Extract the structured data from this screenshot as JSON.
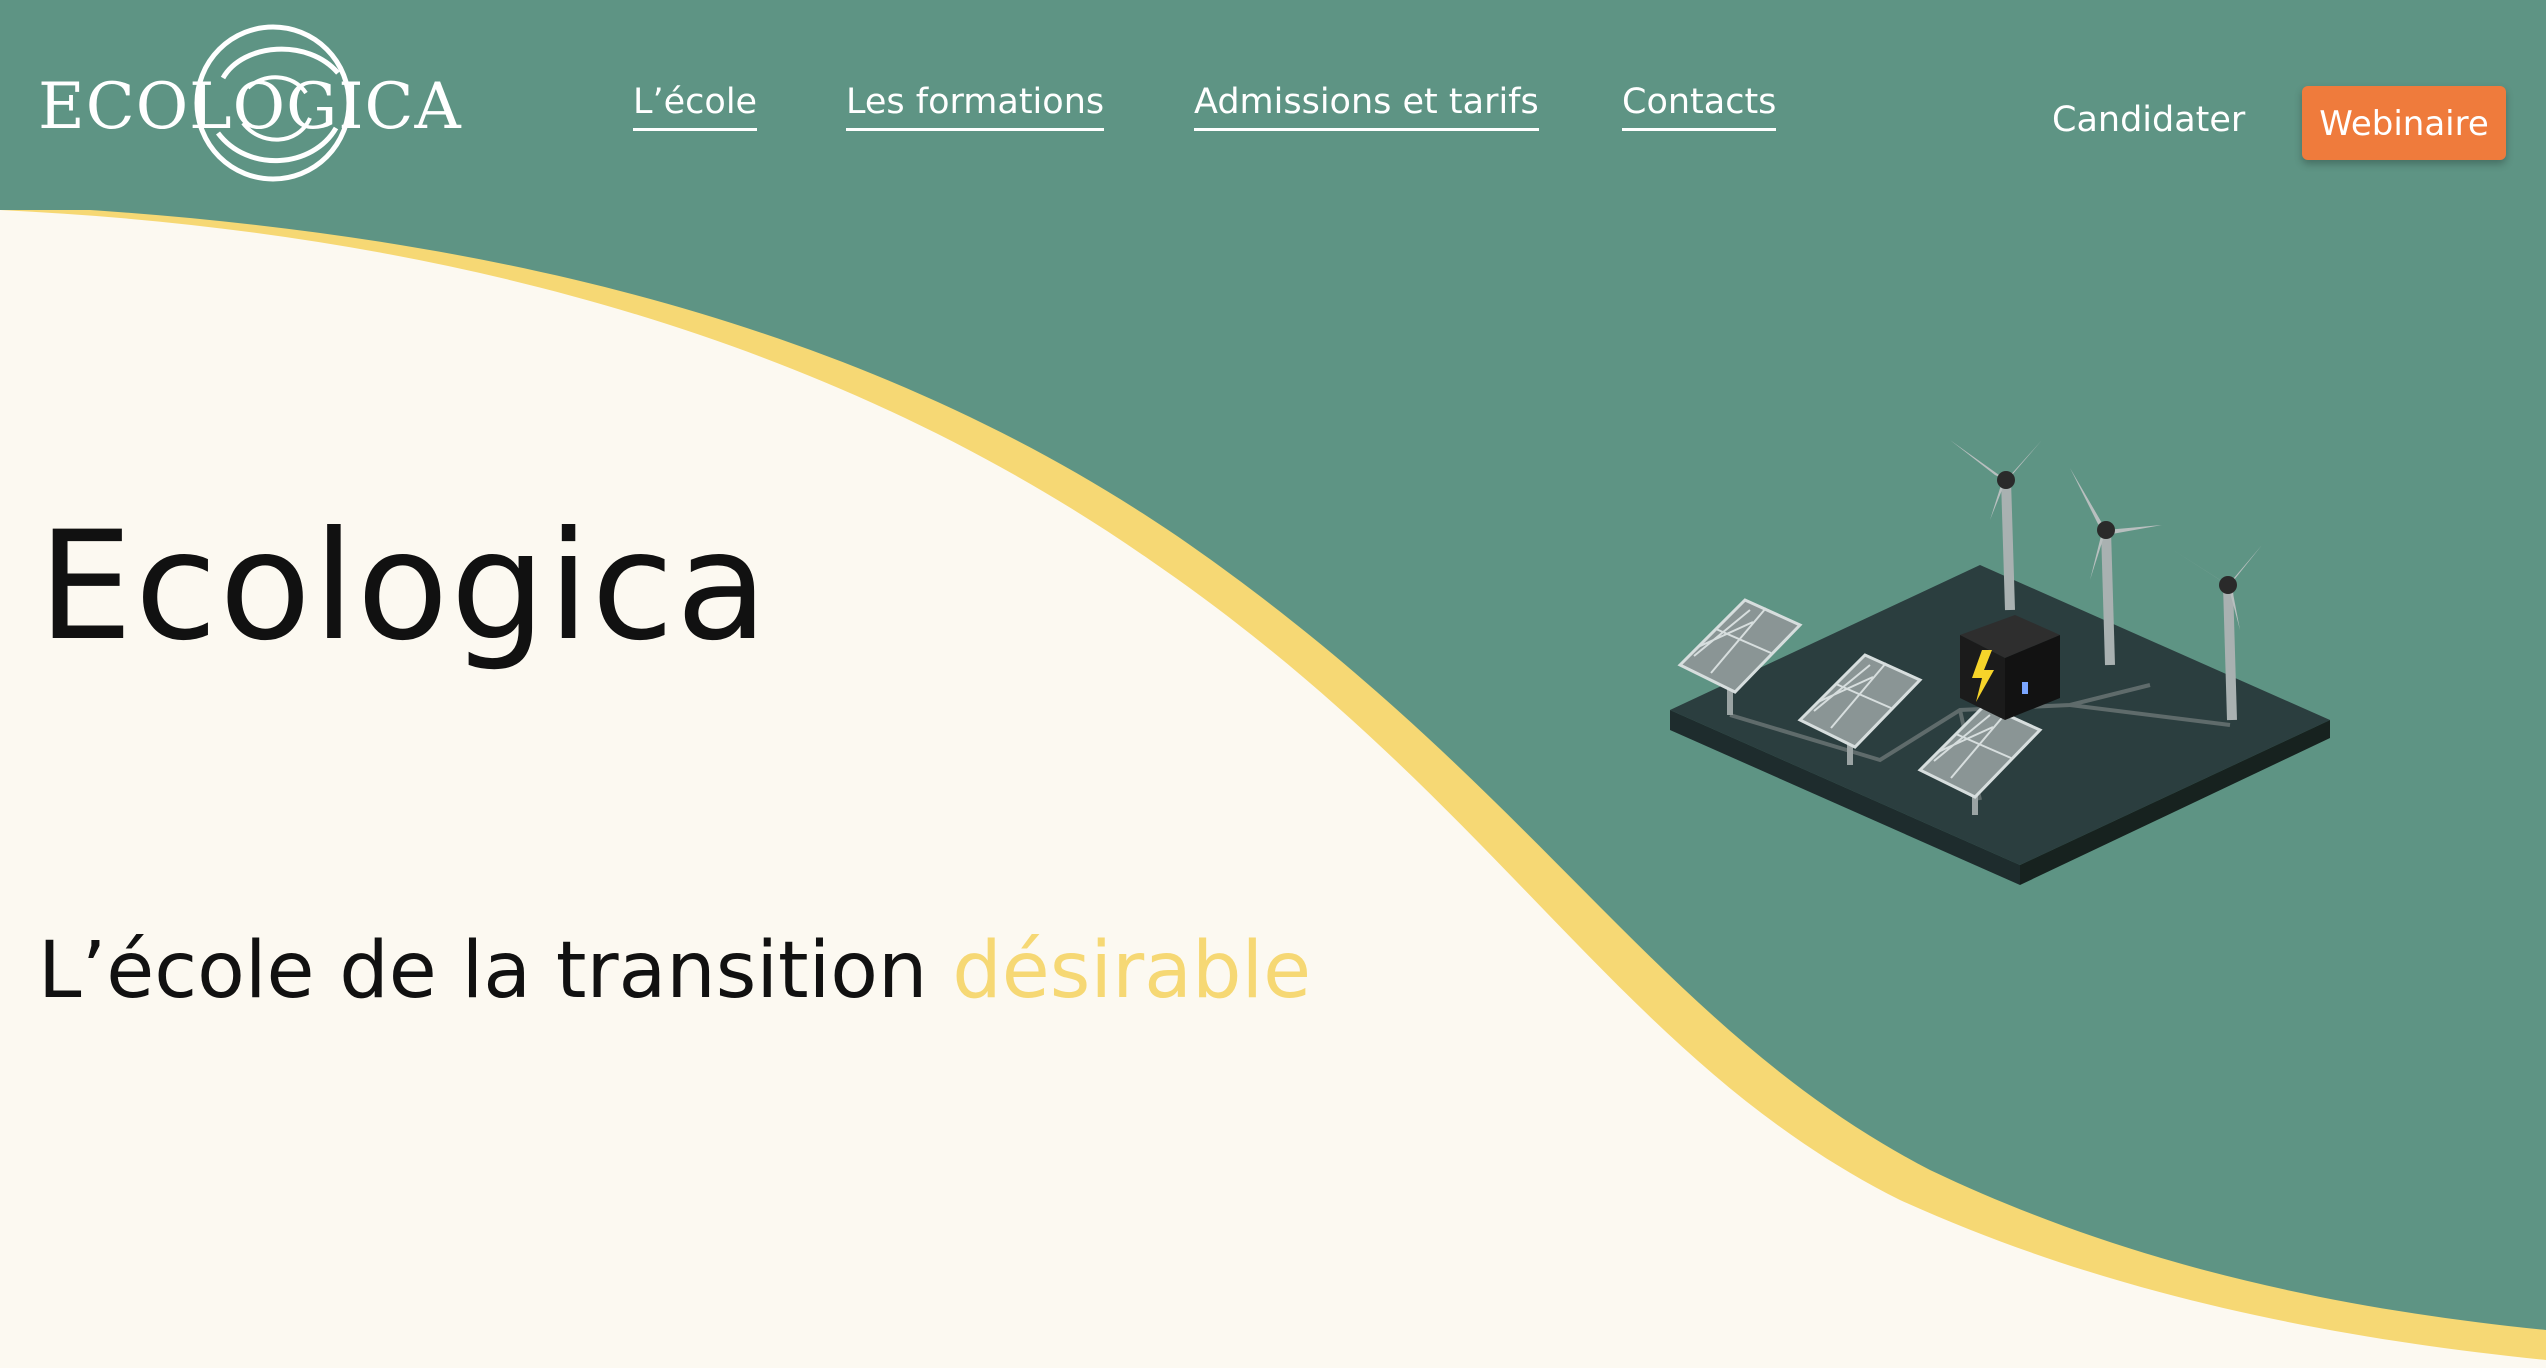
{
  "brand": {
    "logo_text": "ECOLOGICA",
    "colors": {
      "teal": "#5e9484",
      "cream": "#fcf9f1",
      "yellow": "#f6d874",
      "orange": "#ef7b3c"
    }
  },
  "nav": {
    "items": [
      {
        "label": "L’école"
      },
      {
        "label": "Les formations"
      },
      {
        "label": "Admissions et tarifs"
      },
      {
        "label": "Contacts"
      }
    ]
  },
  "actions": {
    "candidater_label": "Candidater",
    "webinaire_label": "Webinaire"
  },
  "hero": {
    "title": "Ecologica",
    "subtitle_prefix": "L’école de la transition ",
    "subtitle_highlight": "désirable"
  },
  "illustration": {
    "icon": "renewable-energy-illustration"
  }
}
